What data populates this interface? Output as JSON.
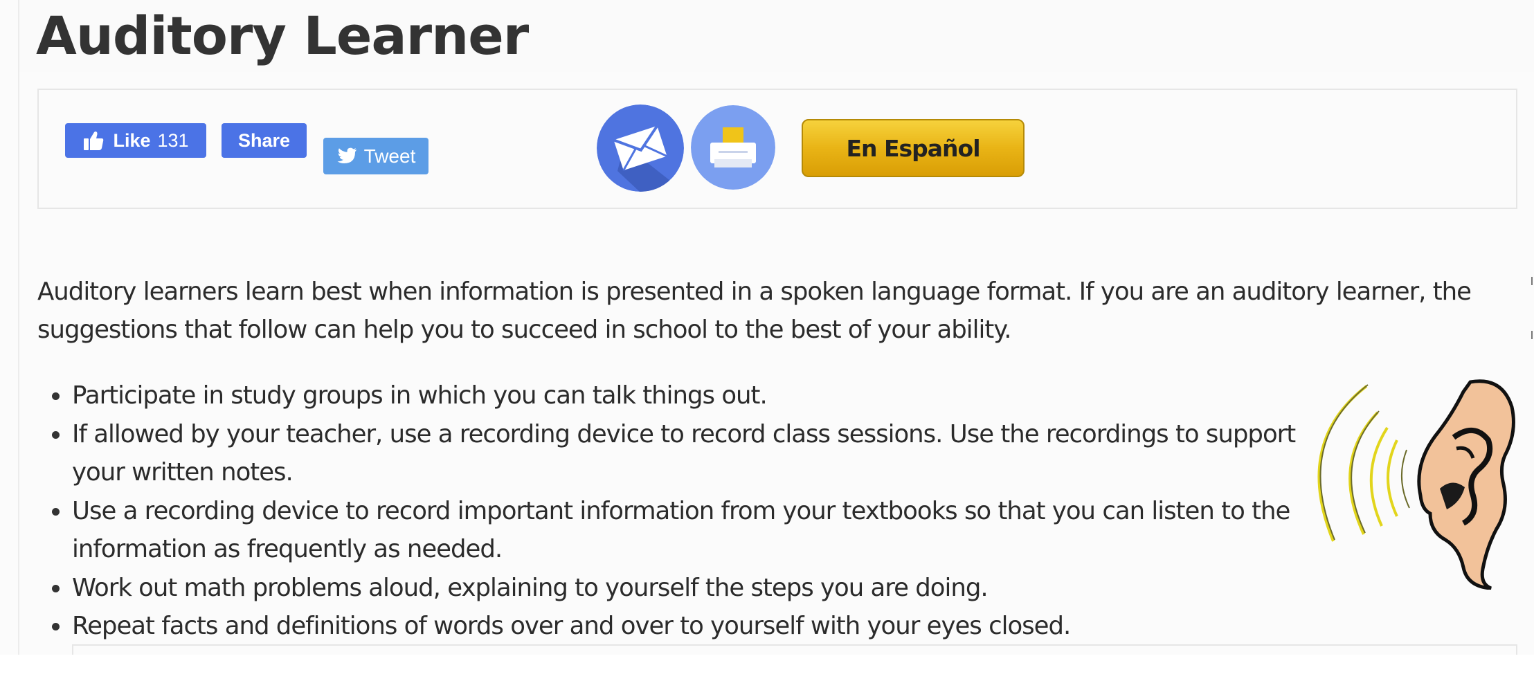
{
  "page": {
    "title": "Auditory Learner"
  },
  "share_bar": {
    "like_label": "Like",
    "like_count": "131",
    "share_label": "Share",
    "tweet_label": "Tweet",
    "spanish_label": "En Español"
  },
  "content": {
    "intro": "Auditory learners learn best when information is presented in a spoken language format. If you are an auditory learner, the suggestions that follow can help you to succeed in school to the best of your ability.",
    "tips": [
      "Participate in study groups in which you can talk things out.",
      "If allowed by your teacher, use a recording device to record class sessions. Use the recordings to support your written notes.",
      "Use a recording device to record important information from your textbooks so that you can listen to the information as frequently as needed.",
      "Work out math problems aloud, explaining to yourself the steps you are doing.",
      "Repeat facts and definitions of words over and over to yourself with your eyes closed."
    ]
  },
  "icons": {
    "like": "thumbs-up-icon",
    "tweet": "twitter-bird-icon",
    "email": "envelope-icon",
    "print": "printer-icon"
  },
  "colors": {
    "facebook": "#4b73e6",
    "twitter": "#5c9de6",
    "email_circle": "#4f74e0",
    "print_circle": "#7b9ff0",
    "espanol_gold": "#e9b416"
  }
}
